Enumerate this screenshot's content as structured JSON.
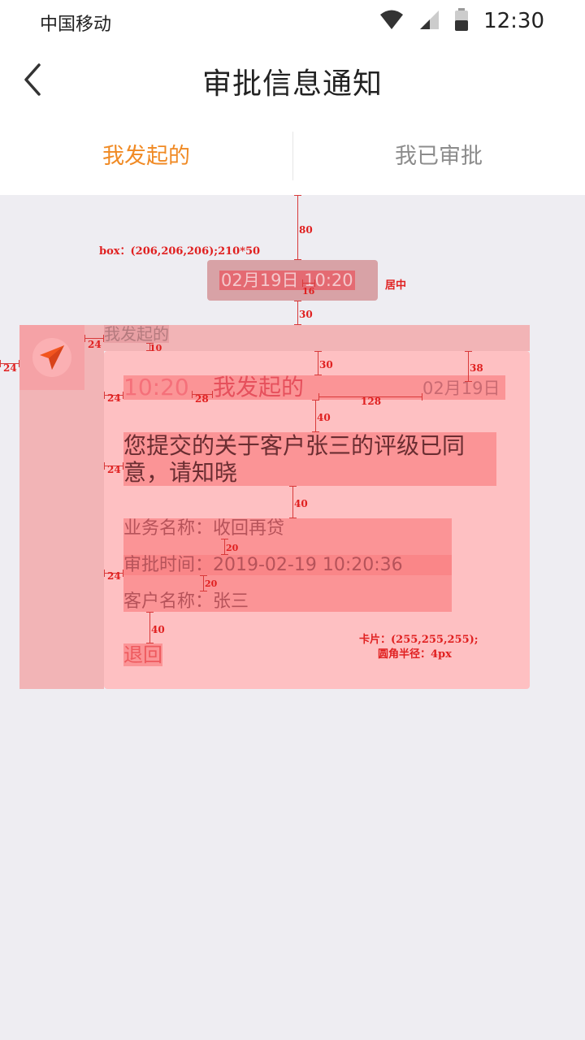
{
  "status_bar": {
    "carrier": "中国移动",
    "time": "12:30"
  },
  "header": {
    "title": "审批信息通知"
  },
  "tabs": [
    {
      "label": "我发起的",
      "active": true
    },
    {
      "label": "我已审批",
      "active": false
    }
  ],
  "notice": {
    "date_badge": "02月19日 10:20",
    "sender": "我发起的",
    "card": {
      "time": "10:20",
      "title": "我发起的",
      "date": "02月19日",
      "message": "您提交的关于客户张三的评级已同意，请知晓",
      "details": [
        {
          "text": "业务名称：收回再贷"
        },
        {
          "text": "审批时间：2019-02-19 10:20:36"
        },
        {
          "text": "客户名称：张三"
        }
      ],
      "action": "退回"
    }
  },
  "annotations": {
    "box_spec": "box：(206,206,206);210*50",
    "centered": "居中",
    "card_spec_line1": "卡片：(255,255,255);",
    "card_spec_line2": "圆角半径：4px",
    "d80": "80",
    "d16": "16",
    "d30a": "30",
    "d24a": "24",
    "d24b": "24",
    "d10": "10",
    "d30b": "30",
    "d38": "38",
    "d24c": "24",
    "d28": "28",
    "d128": "128",
    "d40a": "40",
    "d24d": "24",
    "d40b": "40",
    "d20a": "20",
    "d24e": "24",
    "d20b": "20",
    "d40c": "40"
  },
  "colors": {
    "accent": "#f08a24",
    "tab_inactive": "#8c8c8c",
    "background": "#eeedf2"
  }
}
